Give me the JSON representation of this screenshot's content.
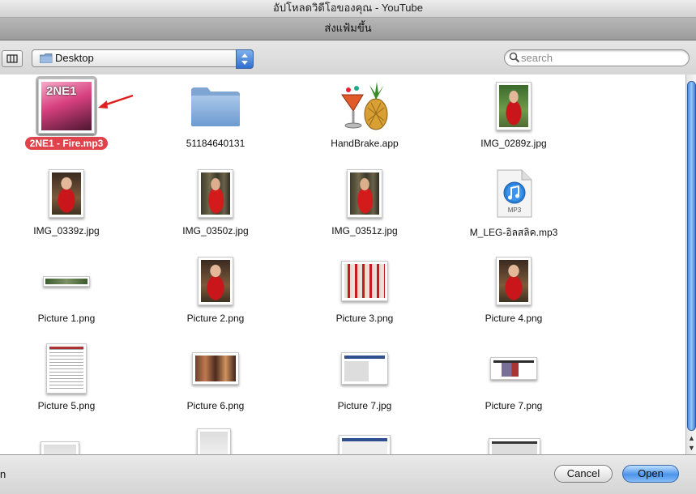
{
  "window": {
    "title": "อัปโหลดวิดีโอของคุณ - YouTube",
    "sheet_title": "ส่งแฟ้มขึ้น"
  },
  "toolbar": {
    "location": "Desktop",
    "search_placeholder": "search"
  },
  "files": [
    {
      "name": "2NE1 - Fire.mp3",
      "kind": "album-art",
      "selected": true,
      "art_text": "2NE1"
    },
    {
      "name": "51184640131",
      "kind": "folder"
    },
    {
      "name": "HandBrake.app",
      "kind": "app"
    },
    {
      "name": "IMG_0289z.jpg",
      "kind": "photo-portrait-green"
    },
    {
      "name": "IMG_0339z.jpg",
      "kind": "photo-portrait"
    },
    {
      "name": "IMG_0350z.jpg",
      "kind": "photo-portrait-forest"
    },
    {
      "name": "IMG_0351z.jpg",
      "kind": "photo-portrait-forest"
    },
    {
      "name": "M_LEG-อิลสลิค.mp3",
      "kind": "mp3"
    },
    {
      "name": "Picture 1.png",
      "kind": "banner"
    },
    {
      "name": "Picture 2.png",
      "kind": "photo-portrait"
    },
    {
      "name": "Picture 3.png",
      "kind": "group-photo"
    },
    {
      "name": "Picture 4.png",
      "kind": "photo-portrait"
    },
    {
      "name": "Picture 5.png",
      "kind": "doc-shot"
    },
    {
      "name": "Picture 6.png",
      "kind": "family-photo"
    },
    {
      "name": "Picture 7.jpg",
      "kind": "web-shot"
    },
    {
      "name": "Picture 7.png",
      "kind": "web-shot2"
    }
  ],
  "partial_row_count": 4,
  "mp3_icon_text": "MP3",
  "bottom": {
    "left_text": "n",
    "cancel_label": "Cancel",
    "open_label": "Open"
  },
  "colors": {
    "selection_label": "#e0434b",
    "annotation_arrow": "#e02020",
    "accent_blue": "#4c93ea"
  }
}
